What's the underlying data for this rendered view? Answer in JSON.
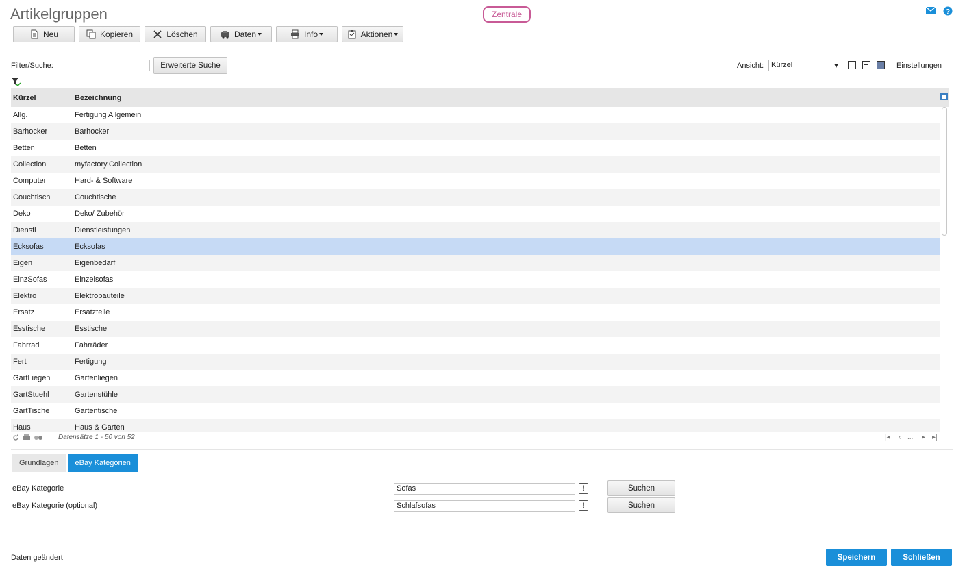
{
  "page": {
    "title": "Artikelgruppen",
    "badge": "Zentrale"
  },
  "toolbar": {
    "buttons": [
      {
        "label": "Neu",
        "icon": "document-icon"
      },
      {
        "label": "Kopieren",
        "icon": "copy-icon"
      },
      {
        "label": "Löschen",
        "icon": "delete-icon"
      },
      {
        "label": "Daten",
        "icon": "database-icon",
        "dropdown": true
      },
      {
        "label": "Info",
        "icon": "printer-icon",
        "dropdown": true
      },
      {
        "label": "Aktionen",
        "icon": "clipboard-icon",
        "dropdown": true
      }
    ]
  },
  "filter": {
    "label": "Filter/Suche:",
    "value": "",
    "extended_search": "Erweiterte Suche",
    "view_label": "Ansicht:",
    "view_value": "Kürzel",
    "settings": "Einstellungen"
  },
  "grid": {
    "columns": [
      "Kürzel",
      "Bezeichnung"
    ],
    "selected_index": 8,
    "rows": [
      [
        "Allg.",
        "Fertigung Allgemein"
      ],
      [
        "Barhocker",
        "Barhocker"
      ],
      [
        "Betten",
        "Betten"
      ],
      [
        "Collection",
        "myfactory.Collection"
      ],
      [
        "Computer",
        "Hard- & Software"
      ],
      [
        "Couchtisch",
        "Couchtische"
      ],
      [
        "Deko",
        "Deko/ Zubehör"
      ],
      [
        "Dienstl",
        "Dienstleistungen"
      ],
      [
        "Ecksofas",
        "Ecksofas"
      ],
      [
        "Eigen",
        "Eigenbedarf"
      ],
      [
        "EinzSofas",
        "Einzelsofas"
      ],
      [
        "Elektro",
        "Elektrobauteile"
      ],
      [
        "Ersatz",
        "Ersatzteile"
      ],
      [
        "Esstische",
        "Esstische"
      ],
      [
        "Fahrrad",
        "Fahrräder"
      ],
      [
        "Fert",
        "Fertigung"
      ],
      [
        "GartLiegen",
        "Gartenliegen"
      ],
      [
        "GartStuehl",
        "Gartenstühle"
      ],
      [
        "GartTische",
        "Gartentische"
      ],
      [
        "Haus",
        "Haus & Garten"
      ]
    ],
    "status": "Datensätze 1 - 50 von 52",
    "pager": [
      "|◂",
      "‹",
      "...",
      "▸",
      "▸|"
    ]
  },
  "tabs": [
    {
      "label": "Grundlagen",
      "active": false
    },
    {
      "label": "eBay Kategorien",
      "active": true
    }
  ],
  "form": {
    "fields": [
      {
        "label": "eBay Kategorie",
        "value": "Sofas",
        "button": "Suchen",
        "hint": "!"
      },
      {
        "label": "eBay Kategorie (optional)",
        "value": "Schlafsofas",
        "button": "Suchen",
        "hint": "!"
      }
    ]
  },
  "footer": {
    "status": "Daten geändert",
    "save": "Speichern",
    "close": "Schließen"
  },
  "colors": {
    "accent": "#1a8fd9",
    "badge": "#c85a96",
    "selected_row": "#c6daf5"
  }
}
